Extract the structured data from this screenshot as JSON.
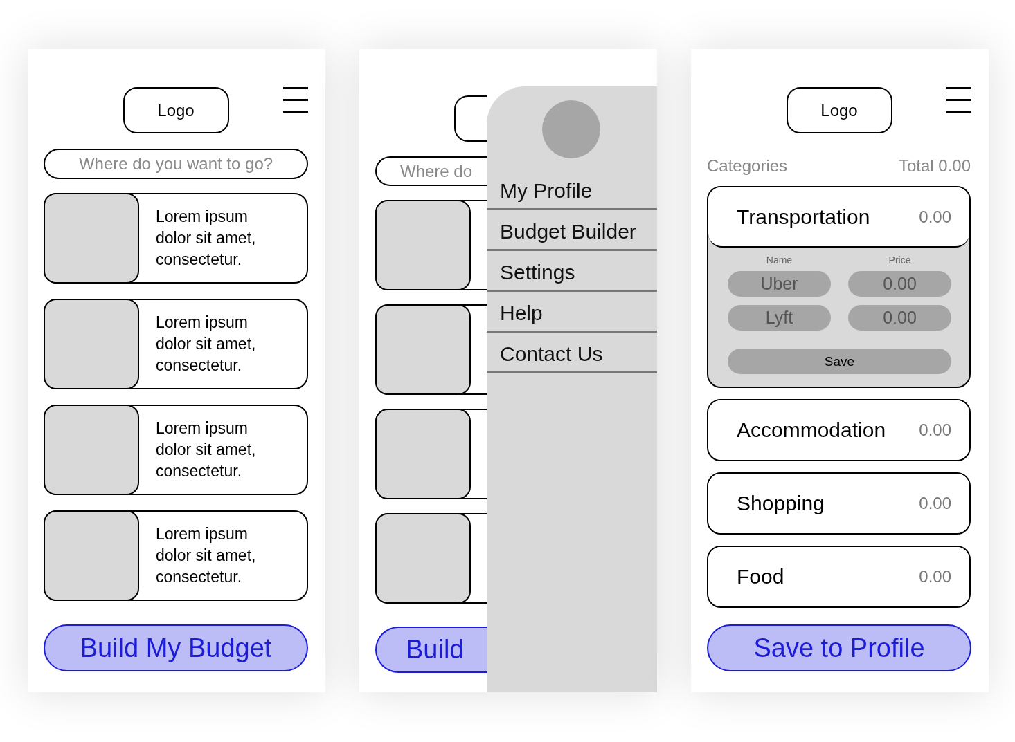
{
  "screens": [
    {
      "kind": "list",
      "logo": "Logo",
      "search": {
        "placeholder": "Where do you want to go?"
      },
      "cards": [
        {
          "kind": "text",
          "text": "Lorem ipsum dolor sit amet, consectetur."
        },
        {
          "kind": "text",
          "text": "Lorem ipsum dolor sit amet, consectetur."
        },
        {
          "kind": "text",
          "text": "Lorem ipsum dolor sit amet, consectetur."
        },
        {
          "kind": "text",
          "text": "Lorem ipsum dolor sit amet, consectetur."
        }
      ],
      "button": "Build My Budget"
    },
    {
      "kind": "menu",
      "search": {
        "placeholder": "Where do"
      },
      "cards": [
        {
          "kind": "blank"
        },
        {
          "kind": "blank"
        },
        {
          "kind": "blank"
        },
        {
          "kind": "blank"
        }
      ],
      "button": "Build",
      "menu": [
        "My Profile",
        "Budget Builder",
        "Settings",
        "Help",
        "Contact Us"
      ]
    },
    {
      "kind": "budget",
      "logo": "Logo",
      "heading": "Categories",
      "total": "Total 0.00",
      "categories": [
        {
          "name": "Transportation",
          "amount": "0.00",
          "expanded": true,
          "name_label": "Name",
          "price_label": "Price",
          "entries": [
            {
              "name": "Uber",
              "price": "0.00"
            },
            {
              "name": "Lyft",
              "price": "0.00"
            }
          ],
          "save": "Save"
        },
        {
          "name": "Accommodation",
          "amount": "0.00",
          "expanded": false
        },
        {
          "name": "Shopping",
          "amount": "0.00",
          "expanded": false
        },
        {
          "name": "Food",
          "amount": "0.00",
          "expanded": false
        }
      ],
      "button": "Save to Profile"
    }
  ]
}
